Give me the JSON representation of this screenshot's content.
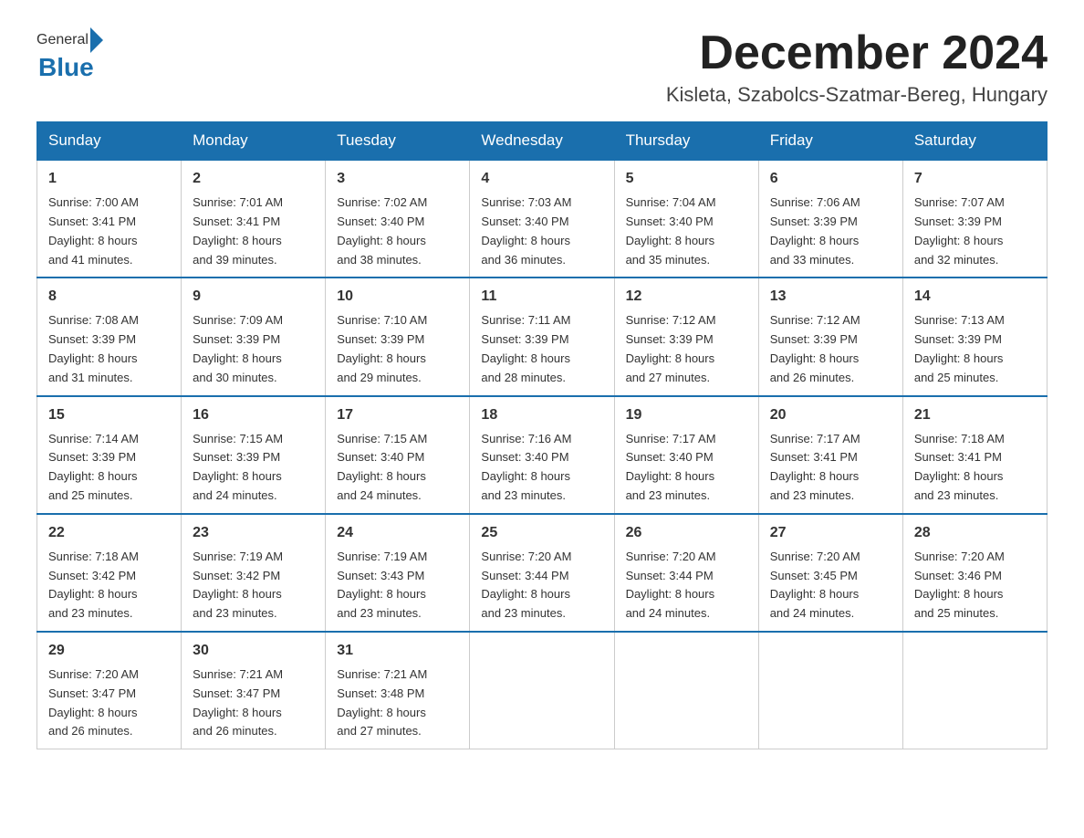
{
  "header": {
    "logo_general": "General",
    "logo_blue": "Blue",
    "month_title": "December 2024",
    "location": "Kisleta, Szabolcs-Szatmar-Bereg, Hungary"
  },
  "weekdays": [
    "Sunday",
    "Monday",
    "Tuesday",
    "Wednesday",
    "Thursday",
    "Friday",
    "Saturday"
  ],
  "weeks": [
    [
      {
        "day": "1",
        "sunrise": "7:00 AM",
        "sunset": "3:41 PM",
        "daylight": "8 hours and 41 minutes."
      },
      {
        "day": "2",
        "sunrise": "7:01 AM",
        "sunset": "3:41 PM",
        "daylight": "8 hours and 39 minutes."
      },
      {
        "day": "3",
        "sunrise": "7:02 AM",
        "sunset": "3:40 PM",
        "daylight": "8 hours and 38 minutes."
      },
      {
        "day": "4",
        "sunrise": "7:03 AM",
        "sunset": "3:40 PM",
        "daylight": "8 hours and 36 minutes."
      },
      {
        "day": "5",
        "sunrise": "7:04 AM",
        "sunset": "3:40 PM",
        "daylight": "8 hours and 35 minutes."
      },
      {
        "day": "6",
        "sunrise": "7:06 AM",
        "sunset": "3:39 PM",
        "daylight": "8 hours and 33 minutes."
      },
      {
        "day": "7",
        "sunrise": "7:07 AM",
        "sunset": "3:39 PM",
        "daylight": "8 hours and 32 minutes."
      }
    ],
    [
      {
        "day": "8",
        "sunrise": "7:08 AM",
        "sunset": "3:39 PM",
        "daylight": "8 hours and 31 minutes."
      },
      {
        "day": "9",
        "sunrise": "7:09 AM",
        "sunset": "3:39 PM",
        "daylight": "8 hours and 30 minutes."
      },
      {
        "day": "10",
        "sunrise": "7:10 AM",
        "sunset": "3:39 PM",
        "daylight": "8 hours and 29 minutes."
      },
      {
        "day": "11",
        "sunrise": "7:11 AM",
        "sunset": "3:39 PM",
        "daylight": "8 hours and 28 minutes."
      },
      {
        "day": "12",
        "sunrise": "7:12 AM",
        "sunset": "3:39 PM",
        "daylight": "8 hours and 27 minutes."
      },
      {
        "day": "13",
        "sunrise": "7:12 AM",
        "sunset": "3:39 PM",
        "daylight": "8 hours and 26 minutes."
      },
      {
        "day": "14",
        "sunrise": "7:13 AM",
        "sunset": "3:39 PM",
        "daylight": "8 hours and 25 minutes."
      }
    ],
    [
      {
        "day": "15",
        "sunrise": "7:14 AM",
        "sunset": "3:39 PM",
        "daylight": "8 hours and 25 minutes."
      },
      {
        "day": "16",
        "sunrise": "7:15 AM",
        "sunset": "3:39 PM",
        "daylight": "8 hours and 24 minutes."
      },
      {
        "day": "17",
        "sunrise": "7:15 AM",
        "sunset": "3:40 PM",
        "daylight": "8 hours and 24 minutes."
      },
      {
        "day": "18",
        "sunrise": "7:16 AM",
        "sunset": "3:40 PM",
        "daylight": "8 hours and 23 minutes."
      },
      {
        "day": "19",
        "sunrise": "7:17 AM",
        "sunset": "3:40 PM",
        "daylight": "8 hours and 23 minutes."
      },
      {
        "day": "20",
        "sunrise": "7:17 AM",
        "sunset": "3:41 PM",
        "daylight": "8 hours and 23 minutes."
      },
      {
        "day": "21",
        "sunrise": "7:18 AM",
        "sunset": "3:41 PM",
        "daylight": "8 hours and 23 minutes."
      }
    ],
    [
      {
        "day": "22",
        "sunrise": "7:18 AM",
        "sunset": "3:42 PM",
        "daylight": "8 hours and 23 minutes."
      },
      {
        "day": "23",
        "sunrise": "7:19 AM",
        "sunset": "3:42 PM",
        "daylight": "8 hours and 23 minutes."
      },
      {
        "day": "24",
        "sunrise": "7:19 AM",
        "sunset": "3:43 PM",
        "daylight": "8 hours and 23 minutes."
      },
      {
        "day": "25",
        "sunrise": "7:20 AM",
        "sunset": "3:44 PM",
        "daylight": "8 hours and 23 minutes."
      },
      {
        "day": "26",
        "sunrise": "7:20 AM",
        "sunset": "3:44 PM",
        "daylight": "8 hours and 24 minutes."
      },
      {
        "day": "27",
        "sunrise": "7:20 AM",
        "sunset": "3:45 PM",
        "daylight": "8 hours and 24 minutes."
      },
      {
        "day": "28",
        "sunrise": "7:20 AM",
        "sunset": "3:46 PM",
        "daylight": "8 hours and 25 minutes."
      }
    ],
    [
      {
        "day": "29",
        "sunrise": "7:20 AM",
        "sunset": "3:47 PM",
        "daylight": "8 hours and 26 minutes."
      },
      {
        "day": "30",
        "sunrise": "7:21 AM",
        "sunset": "3:47 PM",
        "daylight": "8 hours and 26 minutes."
      },
      {
        "day": "31",
        "sunrise": "7:21 AM",
        "sunset": "3:48 PM",
        "daylight": "8 hours and 27 minutes."
      },
      null,
      null,
      null,
      null
    ]
  ],
  "labels": {
    "sunrise": "Sunrise:",
    "sunset": "Sunset:",
    "daylight": "Daylight:"
  }
}
